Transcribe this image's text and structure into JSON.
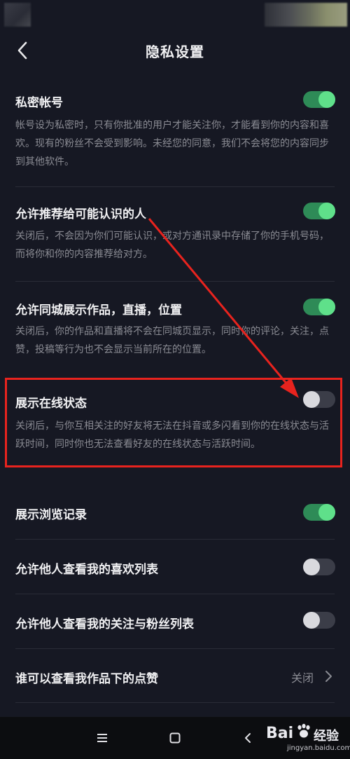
{
  "header": {
    "title": "隐私设置"
  },
  "settings": [
    {
      "title": "私密帐号",
      "desc": "帐号设为私密时，只有你批准的用户才能关注你，才能看到你的内容和喜欢。现有的粉丝不会受到影响。未经您的同意，我们不会将您的内容同步到其他软件。",
      "enabled": true
    },
    {
      "title": "允许推荐给可能认识的人",
      "desc": "关闭后，不会因为你们可能认识，或对方通讯录中存储了你的手机号码，而将你和你的内容推荐给对方。",
      "enabled": true
    },
    {
      "title": "允许同城展示作品，直播，位置",
      "desc": "关闭后，你的作品和直播将不会在同城页显示，同时你的评论，关注，点赞，投稿等行为也不会显示当前所在的位置。",
      "enabled": true
    },
    {
      "title": "展示在线状态",
      "desc": "关闭后，与你互相关注的好友将无法在抖音或多闪看到你的在线状态与活跃时间，同时你也无法查看好友的在线状态与活跃时间。",
      "enabled": false
    },
    {
      "title": "展示浏览记录",
      "enabled": true
    },
    {
      "title": "允许他人查看我的喜欢列表",
      "enabled": false
    },
    {
      "title": "允许他人查看我的关注与粉丝列表",
      "enabled": false
    },
    {
      "title": "谁可以查看我作品下的点赞",
      "value": "关闭"
    }
  ],
  "watermark": {
    "brand": "Bai",
    "brand2": "经验",
    "url": "jingyan.baidu.com"
  },
  "colors": {
    "background": "#161823",
    "toggle_on": "#5fe08a",
    "toggle_off": "#d9d9de",
    "highlight": "#e8231e"
  }
}
